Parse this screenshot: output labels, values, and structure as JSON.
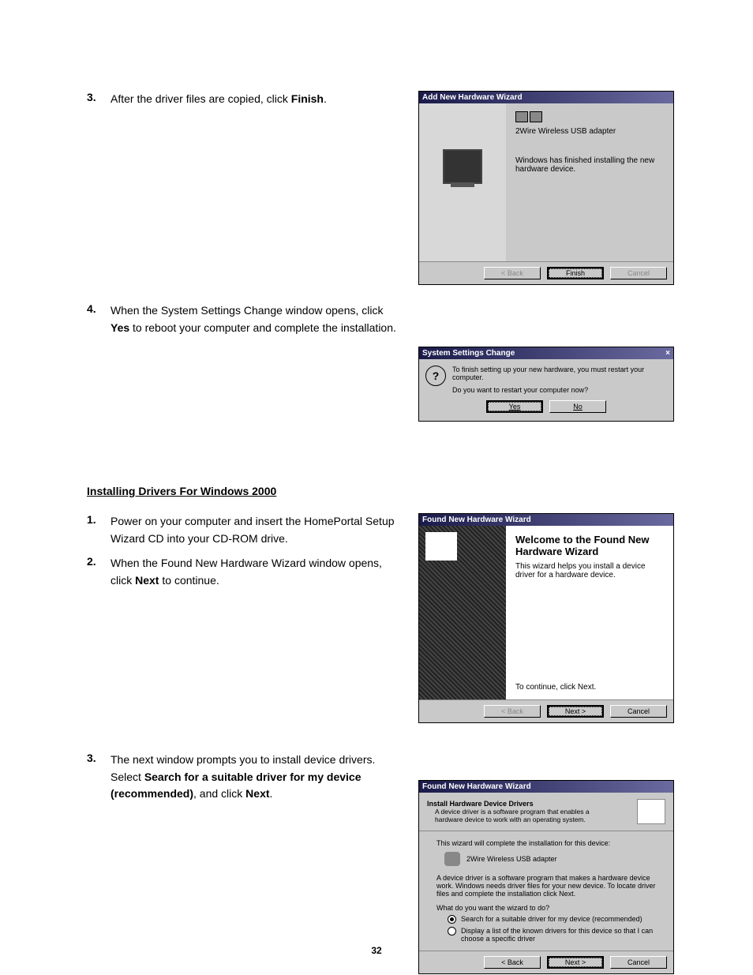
{
  "steps_a": [
    {
      "num": "3.",
      "pre": "After the driver files are copied, click ",
      "bold": "Finish",
      "post": "."
    },
    {
      "num": "4.",
      "pre": "When the System Settings Change window opens, click ",
      "bold": "Yes",
      "post": " to reboot your computer and complete the installation."
    }
  ],
  "section_title": "Installing Drivers For Windows 2000",
  "steps_b": [
    {
      "num": "1.",
      "text": "Power on your computer and insert the HomePortal Setup Wizard CD into your CD-ROM drive."
    },
    {
      "num": "2.",
      "pre": "When the Found New Hardware Wizard window opens, click ",
      "bold": "Next",
      "post": " to continue."
    }
  ],
  "steps_c": [
    {
      "num": "3.",
      "pre": "The next window prompts you to install device drivers. Select ",
      "bold": "Search for a suitable driver for my device (recommended)",
      "mid": ", and click ",
      "bold2": "Next",
      "post": "."
    }
  ],
  "wiz1": {
    "title": "Add New Hardware Wizard",
    "device": "2Wire Wireless USB adapter",
    "done": "Windows has finished installing the new hardware device.",
    "back": "< Back",
    "finish": "Finish",
    "cancel": "Cancel"
  },
  "dlg2": {
    "title": "System Settings Change",
    "line1": "To finish setting up your new hardware, you must restart your computer.",
    "line2": "Do you want to restart your computer now?",
    "yes": "Yes",
    "no": "No",
    "close": "×"
  },
  "wiz3": {
    "title": "Found New Hardware Wizard",
    "welcome": "Welcome to the Found New Hardware Wizard",
    "desc": "This wizard helps you install a device driver for a hardware device.",
    "cont": "To continue, click Next.",
    "back": "< Back",
    "next": "Next >",
    "cancel": "Cancel"
  },
  "wiz4": {
    "title": "Found New Hardware Wizard",
    "header_title": "Install Hardware Device Drivers",
    "header_sub": "A device driver is a software program that enables a hardware device to work with an operating system.",
    "complete": "This wizard will complete the installation for this device:",
    "device": "2Wire Wireless USB adapter",
    "explain": "A device driver is a software program that makes a hardware device work. Windows needs driver files for your new device. To locate driver files and complete the installation click Next.",
    "prompt": "What do you want the wizard to do?",
    "opt1": "Search for a suitable driver for my device (recommended)",
    "opt2": "Display a list of the known drivers for this device so that I can choose a specific driver",
    "back": "< Back",
    "next": "Next >",
    "cancel": "Cancel"
  },
  "page_number": "32"
}
